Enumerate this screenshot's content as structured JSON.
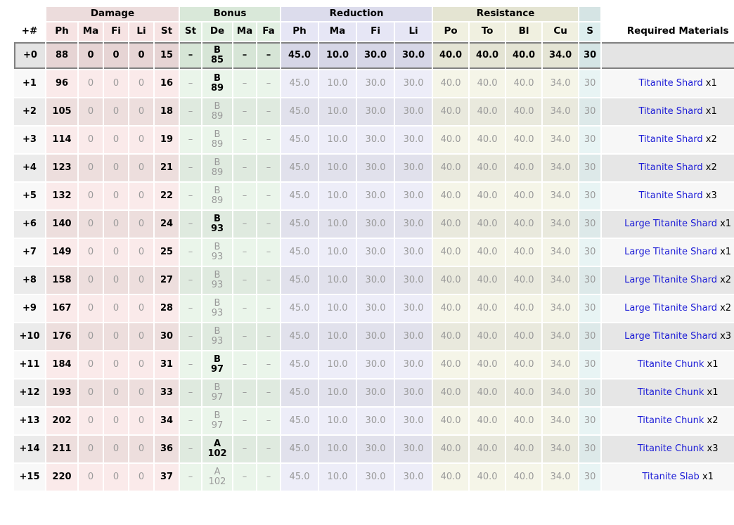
{
  "table": {
    "groups": [
      {
        "label": "",
        "span": 1,
        "kind": "gap"
      },
      {
        "label": "Damage",
        "span": 5,
        "kind": "g-damage"
      },
      {
        "label": "Bonus",
        "span": 4,
        "kind": "g-bonus"
      },
      {
        "label": "Reduction",
        "span": 4,
        "kind": "g-reduction"
      },
      {
        "label": "Resistance",
        "span": 4,
        "kind": "g-resist"
      },
      {
        "label": "",
        "span": 1,
        "kind": "g-spec"
      },
      {
        "label": "",
        "span": 1,
        "kind": "gap"
      }
    ],
    "columns": [
      {
        "label": "+#",
        "kind": "h-plus"
      },
      {
        "label": "Ph",
        "kind": "h-damage"
      },
      {
        "label": "Ma",
        "kind": "h-damage"
      },
      {
        "label": "Fi",
        "kind": "h-damage"
      },
      {
        "label": "Li",
        "kind": "h-damage"
      },
      {
        "label": "St",
        "kind": "h-damage"
      },
      {
        "label": "St",
        "kind": "h-bonus"
      },
      {
        "label": "De",
        "kind": "h-bonus"
      },
      {
        "label": "Ma",
        "kind": "h-bonus"
      },
      {
        "label": "Fa",
        "kind": "h-bonus"
      },
      {
        "label": "Ph",
        "kind": "h-red"
      },
      {
        "label": "Ma",
        "kind": "h-red"
      },
      {
        "label": "Fi",
        "kind": "h-red"
      },
      {
        "label": "Li",
        "kind": "h-red"
      },
      {
        "label": "Po",
        "kind": "h-res"
      },
      {
        "label": "To",
        "kind": "h-res"
      },
      {
        "label": "Bl",
        "kind": "h-res"
      },
      {
        "label": "Cu",
        "kind": "h-res"
      },
      {
        "label": "S",
        "kind": "h-spec"
      },
      {
        "label": "Required Materials",
        "kind": "h-mats"
      }
    ],
    "rows": [
      {
        "level": "+0",
        "damage": [
          "88",
          "0",
          "0",
          "0",
          "15"
        ],
        "bonus_st": "–",
        "bonus_de": {
          "grade": "B",
          "value": "85"
        },
        "bonus_ma": "–",
        "bonus_fa": "–",
        "reduction": [
          "45.0",
          "10.0",
          "30.0",
          "30.0"
        ],
        "resistance": [
          "40.0",
          "40.0",
          "40.0",
          "34.0"
        ],
        "special": "30",
        "material": "",
        "quantity": ""
      },
      {
        "level": "+1",
        "damage": [
          "96",
          "0",
          "0",
          "0",
          "16"
        ],
        "bonus_st": "–",
        "bonus_de": {
          "grade": "B",
          "value": "89"
        },
        "bonus_ma": "–",
        "bonus_fa": "–",
        "reduction": [
          "45.0",
          "10.0",
          "30.0",
          "30.0"
        ],
        "resistance": [
          "40.0",
          "40.0",
          "40.0",
          "34.0"
        ],
        "special": "30",
        "material": "Titanite Shard",
        "quantity": "x1"
      },
      {
        "level": "+2",
        "damage": [
          "105",
          "0",
          "0",
          "0",
          "18"
        ],
        "bonus_st": "–",
        "bonus_de": {
          "grade": "B",
          "value": "89"
        },
        "bonus_ma": "–",
        "bonus_fa": "–",
        "reduction": [
          "45.0",
          "10.0",
          "30.0",
          "30.0"
        ],
        "resistance": [
          "40.0",
          "40.0",
          "40.0",
          "34.0"
        ],
        "special": "30",
        "material": "Titanite Shard",
        "quantity": "x1"
      },
      {
        "level": "+3",
        "damage": [
          "114",
          "0",
          "0",
          "0",
          "19"
        ],
        "bonus_st": "–",
        "bonus_de": {
          "grade": "B",
          "value": "89"
        },
        "bonus_ma": "–",
        "bonus_fa": "–",
        "reduction": [
          "45.0",
          "10.0",
          "30.0",
          "30.0"
        ],
        "resistance": [
          "40.0",
          "40.0",
          "40.0",
          "34.0"
        ],
        "special": "30",
        "material": "Titanite Shard",
        "quantity": "x2"
      },
      {
        "level": "+4",
        "damage": [
          "123",
          "0",
          "0",
          "0",
          "21"
        ],
        "bonus_st": "–",
        "bonus_de": {
          "grade": "B",
          "value": "89"
        },
        "bonus_ma": "–",
        "bonus_fa": "–",
        "reduction": [
          "45.0",
          "10.0",
          "30.0",
          "30.0"
        ],
        "resistance": [
          "40.0",
          "40.0",
          "40.0",
          "34.0"
        ],
        "special": "30",
        "material": "Titanite Shard",
        "quantity": "x2"
      },
      {
        "level": "+5",
        "damage": [
          "132",
          "0",
          "0",
          "0",
          "22"
        ],
        "bonus_st": "–",
        "bonus_de": {
          "grade": "B",
          "value": "89"
        },
        "bonus_ma": "–",
        "bonus_fa": "–",
        "reduction": [
          "45.0",
          "10.0",
          "30.0",
          "30.0"
        ],
        "resistance": [
          "40.0",
          "40.0",
          "40.0",
          "34.0"
        ],
        "special": "30",
        "material": "Titanite Shard",
        "quantity": "x3"
      },
      {
        "level": "+6",
        "damage": [
          "140",
          "0",
          "0",
          "0",
          "24"
        ],
        "bonus_st": "–",
        "bonus_de": {
          "grade": "B",
          "value": "93"
        },
        "bonus_ma": "–",
        "bonus_fa": "–",
        "reduction": [
          "45.0",
          "10.0",
          "30.0",
          "30.0"
        ],
        "resistance": [
          "40.0",
          "40.0",
          "40.0",
          "34.0"
        ],
        "special": "30",
        "material": "Large Titanite Shard",
        "quantity": "x1"
      },
      {
        "level": "+7",
        "damage": [
          "149",
          "0",
          "0",
          "0",
          "25"
        ],
        "bonus_st": "–",
        "bonus_de": {
          "grade": "B",
          "value": "93"
        },
        "bonus_ma": "–",
        "bonus_fa": "–",
        "reduction": [
          "45.0",
          "10.0",
          "30.0",
          "30.0"
        ],
        "resistance": [
          "40.0",
          "40.0",
          "40.0",
          "34.0"
        ],
        "special": "30",
        "material": "Large Titanite Shard",
        "quantity": "x1"
      },
      {
        "level": "+8",
        "damage": [
          "158",
          "0",
          "0",
          "0",
          "27"
        ],
        "bonus_st": "–",
        "bonus_de": {
          "grade": "B",
          "value": "93"
        },
        "bonus_ma": "–",
        "bonus_fa": "–",
        "reduction": [
          "45.0",
          "10.0",
          "30.0",
          "30.0"
        ],
        "resistance": [
          "40.0",
          "40.0",
          "40.0",
          "34.0"
        ],
        "special": "30",
        "material": "Large Titanite Shard",
        "quantity": "x2"
      },
      {
        "level": "+9",
        "damage": [
          "167",
          "0",
          "0",
          "0",
          "28"
        ],
        "bonus_st": "–",
        "bonus_de": {
          "grade": "B",
          "value": "93"
        },
        "bonus_ma": "–",
        "bonus_fa": "–",
        "reduction": [
          "45.0",
          "10.0",
          "30.0",
          "30.0"
        ],
        "resistance": [
          "40.0",
          "40.0",
          "40.0",
          "34.0"
        ],
        "special": "30",
        "material": "Large Titanite Shard",
        "quantity": "x2"
      },
      {
        "level": "+10",
        "damage": [
          "176",
          "0",
          "0",
          "0",
          "30"
        ],
        "bonus_st": "–",
        "bonus_de": {
          "grade": "B",
          "value": "93"
        },
        "bonus_ma": "–",
        "bonus_fa": "–",
        "reduction": [
          "45.0",
          "10.0",
          "30.0",
          "30.0"
        ],
        "resistance": [
          "40.0",
          "40.0",
          "40.0",
          "34.0"
        ],
        "special": "30",
        "material": "Large Titanite Shard",
        "quantity": "x3"
      },
      {
        "level": "+11",
        "damage": [
          "184",
          "0",
          "0",
          "0",
          "31"
        ],
        "bonus_st": "–",
        "bonus_de": {
          "grade": "B",
          "value": "97"
        },
        "bonus_ma": "–",
        "bonus_fa": "–",
        "reduction": [
          "45.0",
          "10.0",
          "30.0",
          "30.0"
        ],
        "resistance": [
          "40.0",
          "40.0",
          "40.0",
          "34.0"
        ],
        "special": "30",
        "material": "Titanite Chunk",
        "quantity": "x1"
      },
      {
        "level": "+12",
        "damage": [
          "193",
          "0",
          "0",
          "0",
          "33"
        ],
        "bonus_st": "–",
        "bonus_de": {
          "grade": "B",
          "value": "97"
        },
        "bonus_ma": "–",
        "bonus_fa": "–",
        "reduction": [
          "45.0",
          "10.0",
          "30.0",
          "30.0"
        ],
        "resistance": [
          "40.0",
          "40.0",
          "40.0",
          "34.0"
        ],
        "special": "30",
        "material": "Titanite Chunk",
        "quantity": "x1"
      },
      {
        "level": "+13",
        "damage": [
          "202",
          "0",
          "0",
          "0",
          "34"
        ],
        "bonus_st": "–",
        "bonus_de": {
          "grade": "B",
          "value": "97"
        },
        "bonus_ma": "–",
        "bonus_fa": "–",
        "reduction": [
          "45.0",
          "10.0",
          "30.0",
          "30.0"
        ],
        "resistance": [
          "40.0",
          "40.0",
          "40.0",
          "34.0"
        ],
        "special": "30",
        "material": "Titanite Chunk",
        "quantity": "x2"
      },
      {
        "level": "+14",
        "damage": [
          "211",
          "0",
          "0",
          "0",
          "36"
        ],
        "bonus_st": "–",
        "bonus_de": {
          "grade": "A",
          "value": "102"
        },
        "bonus_ma": "–",
        "bonus_fa": "–",
        "reduction": [
          "45.0",
          "10.0",
          "30.0",
          "30.0"
        ],
        "resistance": [
          "40.0",
          "40.0",
          "40.0",
          "34.0"
        ],
        "special": "30",
        "material": "Titanite Chunk",
        "quantity": "x3"
      },
      {
        "level": "+15",
        "damage": [
          "220",
          "0",
          "0",
          "0",
          "37"
        ],
        "bonus_st": "–",
        "bonus_de": {
          "grade": "A",
          "value": "102"
        },
        "bonus_ma": "–",
        "bonus_fa": "–",
        "reduction": [
          "45.0",
          "10.0",
          "30.0",
          "30.0"
        ],
        "resistance": [
          "40.0",
          "40.0",
          "40.0",
          "34.0"
        ],
        "special": "30",
        "material": "Titanite Slab",
        "quantity": "x1"
      }
    ]
  },
  "colors": {
    "damage_group": "#ecdcdc",
    "bonus_group": "#d9e8d9",
    "reduction_group": "#dcdcec",
    "resistance_group": "#e4e4d2",
    "special_group": "#d5e4e4",
    "link": "#1b1bd6",
    "repeated_value": "#9a9a9a",
    "highlight_border": "#808080"
  }
}
